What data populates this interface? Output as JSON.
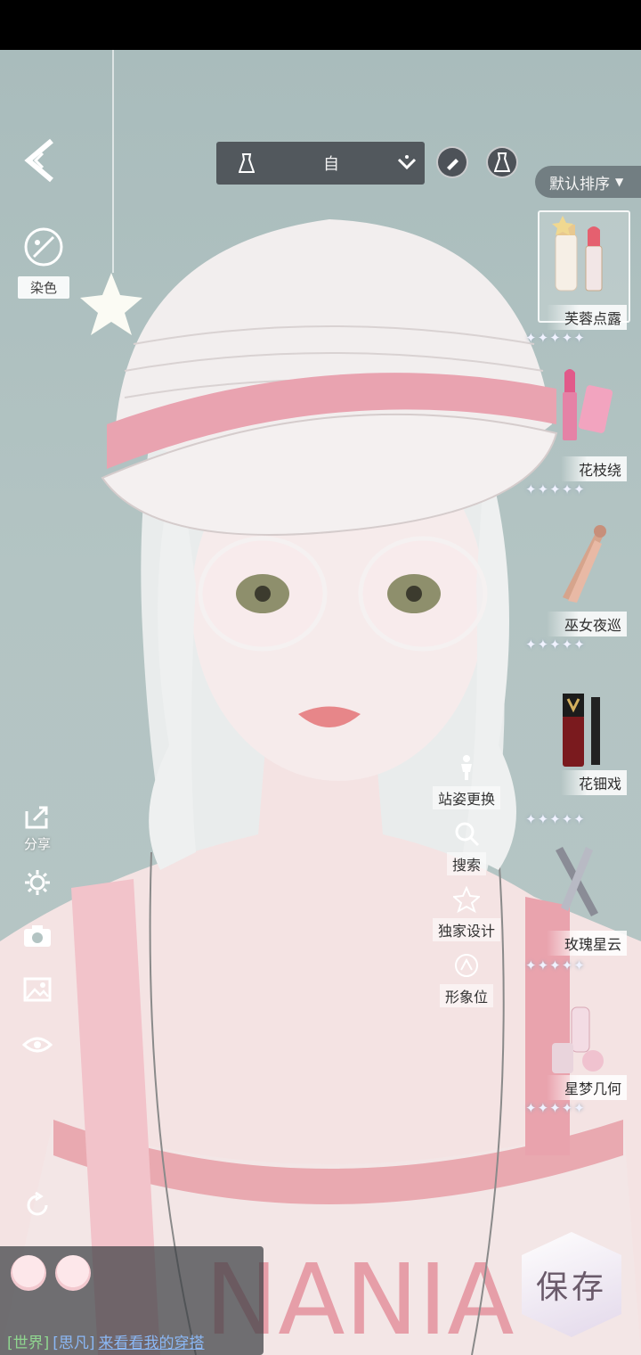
{
  "top_selector": {
    "label": "自"
  },
  "sort": {
    "label": "默认排序"
  },
  "left_tools": {
    "dye_label": "染色",
    "share_label": "分享"
  },
  "mid_menu": [
    {
      "label": "站姿更换",
      "icon": "figure-icon"
    },
    {
      "label": "搜索",
      "icon": "search-icon"
    },
    {
      "label": "独家设计",
      "icon": "star-icon"
    },
    {
      "label": "形象位",
      "icon": "hanger-icon"
    }
  ],
  "products": [
    {
      "name": "芙蓉点露",
      "stars": "✦✦✦✦✦",
      "selected": true
    },
    {
      "name": "花枝绕",
      "stars": "✦✦✦✦✦"
    },
    {
      "name": "巫女夜巡",
      "stars": "✦✦✦✦✦"
    },
    {
      "name": "花钿戏",
      "stars": "✦✦✦✦✦"
    },
    {
      "name": "玫瑰星云",
      "stars": "✦✦✦✦✦"
    },
    {
      "name": "星梦几何",
      "stars": "✦✦✦✦✦"
    }
  ],
  "save": {
    "label": "保存"
  },
  "chat": {
    "channel": "[世界]",
    "user": "[思凡]",
    "message": "来看看我的穿搭"
  },
  "colors": {
    "accent_pink": "#e9a3b0",
    "panel": "#464a50"
  }
}
